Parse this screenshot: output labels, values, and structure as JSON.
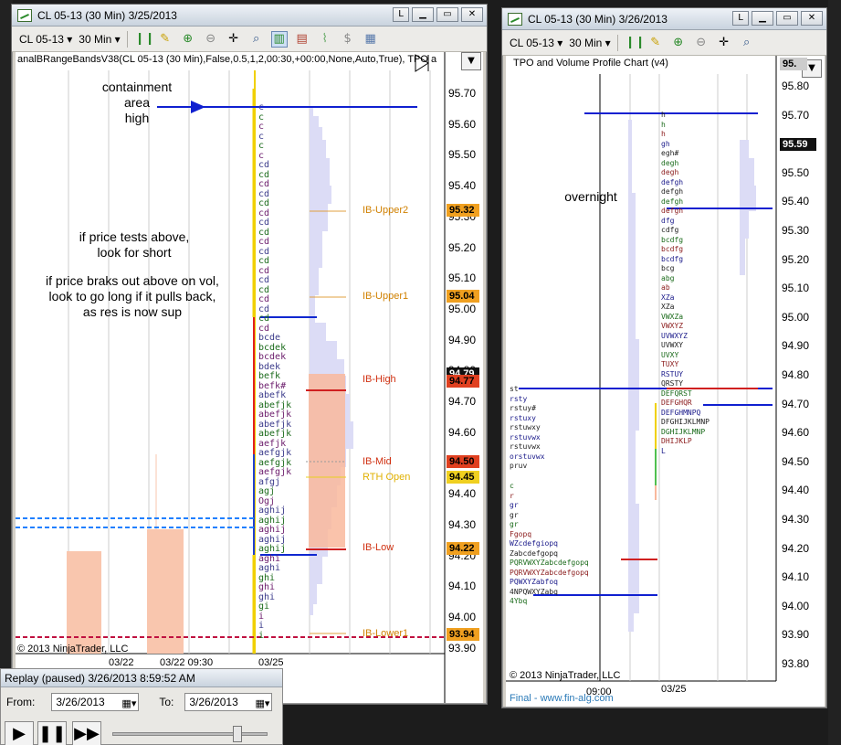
{
  "left_window": {
    "title": "CL 05-13 (30 Min)  3/25/2013",
    "toolbar": {
      "instrument": "CL 05-13",
      "interval": "30 Min"
    },
    "indicator": "analBRangeBandsV38(CL 05-13 (30 Min),False,0.5,1,2,00:30,+00:00,None,Auto,True), TPO a",
    "price_axis": [
      "95.70",
      "95.60",
      "95.50",
      "95.40",
      "95.30",
      "95.20",
      "95.10",
      "95.00",
      "94.90",
      "94.80",
      "94.70",
      "94.60",
      "94.50",
      "94.40",
      "94.30",
      "94.20",
      "94.10",
      "94.00",
      "93.90"
    ],
    "price_tags": [
      {
        "text": "95.32",
        "color": "#f0a020"
      },
      {
        "text": "95.04",
        "color": "#f0a020"
      },
      {
        "text": "94.79",
        "color": "#111111",
        "fg": "#ffffff"
      },
      {
        "text": "94.77",
        "color": "#e04020"
      },
      {
        "text": "94.50",
        "color": "#e04020"
      },
      {
        "text": "94.45",
        "color": "#f0d020"
      },
      {
        "text": "94.22",
        "color": "#f0a020"
      },
      {
        "text": "93.94",
        "color": "#f0a020"
      }
    ],
    "levels": {
      "ib_upper2": "IB-Upper2",
      "ib_upper1": "IB-Upper1",
      "ib_high": "IB-High",
      "ib_mid": "IB-Mid",
      "rth_open": "RTH Open",
      "ib_low": "IB-Low",
      "ib_lower1": "IB-Lower1"
    },
    "notes": {
      "containment": "containment\narea\nhigh",
      "short": "if price tests above,\nlook for short",
      "breakout": "if price braks out above on vol,\nlook to go long if it pulls back,\nas res is now sup"
    },
    "copyright": "© 2013 NinjaTrader, LLC",
    "dates": [
      "03/22",
      "03/22 09:30",
      "03/25"
    ],
    "tpo_rows": [
      "c",
      "c",
      "c",
      "c",
      "c",
      "c",
      "cd",
      "cd",
      "cd",
      "cd",
      "cd",
      "cd",
      "cd",
      "cd",
      "cd",
      "cd",
      "cd",
      "cd",
      "cd",
      "cd",
      "cd",
      "cd",
      "cd",
      "cd",
      "bcde",
      "bcdek",
      "bcdek",
      "bdek",
      "befk",
      "befk#",
      "abefk",
      "abefjk",
      "abefjk",
      "abefjk",
      "abefjk",
      "aefjk",
      "aefgjk",
      "aefgjk",
      "aefgjk",
      "afgj",
      "agj",
      "Ogj",
      "aghij",
      "aghij",
      "aghij",
      "aghij",
      "aghij",
      "aghi",
      "aghi",
      "ghi",
      "ghi",
      "ghi",
      "gi",
      "i",
      "i",
      "i"
    ]
  },
  "right_window": {
    "title": "CL 05-13 (30 Min)  3/26/2013",
    "toolbar": {
      "instrument": "CL 05-13",
      "interval": "30 Min"
    },
    "indicator": "TPO and Volume Profile Chart (v4)",
    "price_axis": [
      "95.80",
      "95.70",
      "95.60",
      "95.50",
      "95.40",
      "95.30",
      "95.20",
      "95.10",
      "95.00",
      "94.90",
      "94.80",
      "94.70",
      "94.60",
      "94.50",
      "94.40",
      "94.30",
      "94.20",
      "94.10",
      "94.00",
      "93.90",
      "93.80"
    ],
    "top_tag": "95.",
    "last_price": "95.59",
    "note": "overnight",
    "copyright": "© 2013 NinjaTrader, LLC",
    "footer_link": "Final - www.fin-alg.com",
    "dates": [
      "09:00",
      "03/25"
    ],
    "tpo_main": [
      "h",
      "h",
      "h",
      "gh",
      "egh#",
      "degh",
      "degh",
      "defgh",
      "defgh",
      "defgh",
      "defgh",
      "dfg",
      "cdfg",
      "bcdfg",
      "bcdfg",
      "bcdfg",
      "bcg",
      "abg",
      "ab",
      "XZa",
      "XZa",
      "VWXZa",
      "VWXYZ",
      "UVWXYZ",
      "UVWXY",
      "UVXY",
      "TUXY",
      "RSTUY",
      "QRSTY",
      "DEFQRST",
      "DEFGHQR",
      "DEFGHMNPQ",
      "DFGHIJKLMNP",
      "DGHIJKLMNP",
      "DHIJKLP",
      "L"
    ],
    "tpo_left": [
      "st",
      "rsty",
      "rstuy#",
      "rstuxy",
      "rstuwxy",
      "rstuvwx",
      "rstuvwx",
      "orstuvwx",
      "pruv"
    ],
    "tpo_low": [
      "c",
      "r",
      "gr",
      "gr",
      "gr",
      "Fgopq",
      "WZcdefgiopq",
      "Zabcdefgopq",
      "PQRVWXYZabcdefgopq",
      "PQRVWXYZabcdefgopq",
      "PQWXYZabfoq",
      "4NPQWXYZabq",
      "4Ybq"
    ]
  },
  "replay": {
    "title": "Replay (paused) 3/26/2013 8:59:52 AM",
    "from_label": "From:",
    "from_value": "3/26/2013",
    "to_label": "To:",
    "to_value": "3/26/2013",
    "play": "▶",
    "pause": "❚❚",
    "fast": "▶▶"
  }
}
